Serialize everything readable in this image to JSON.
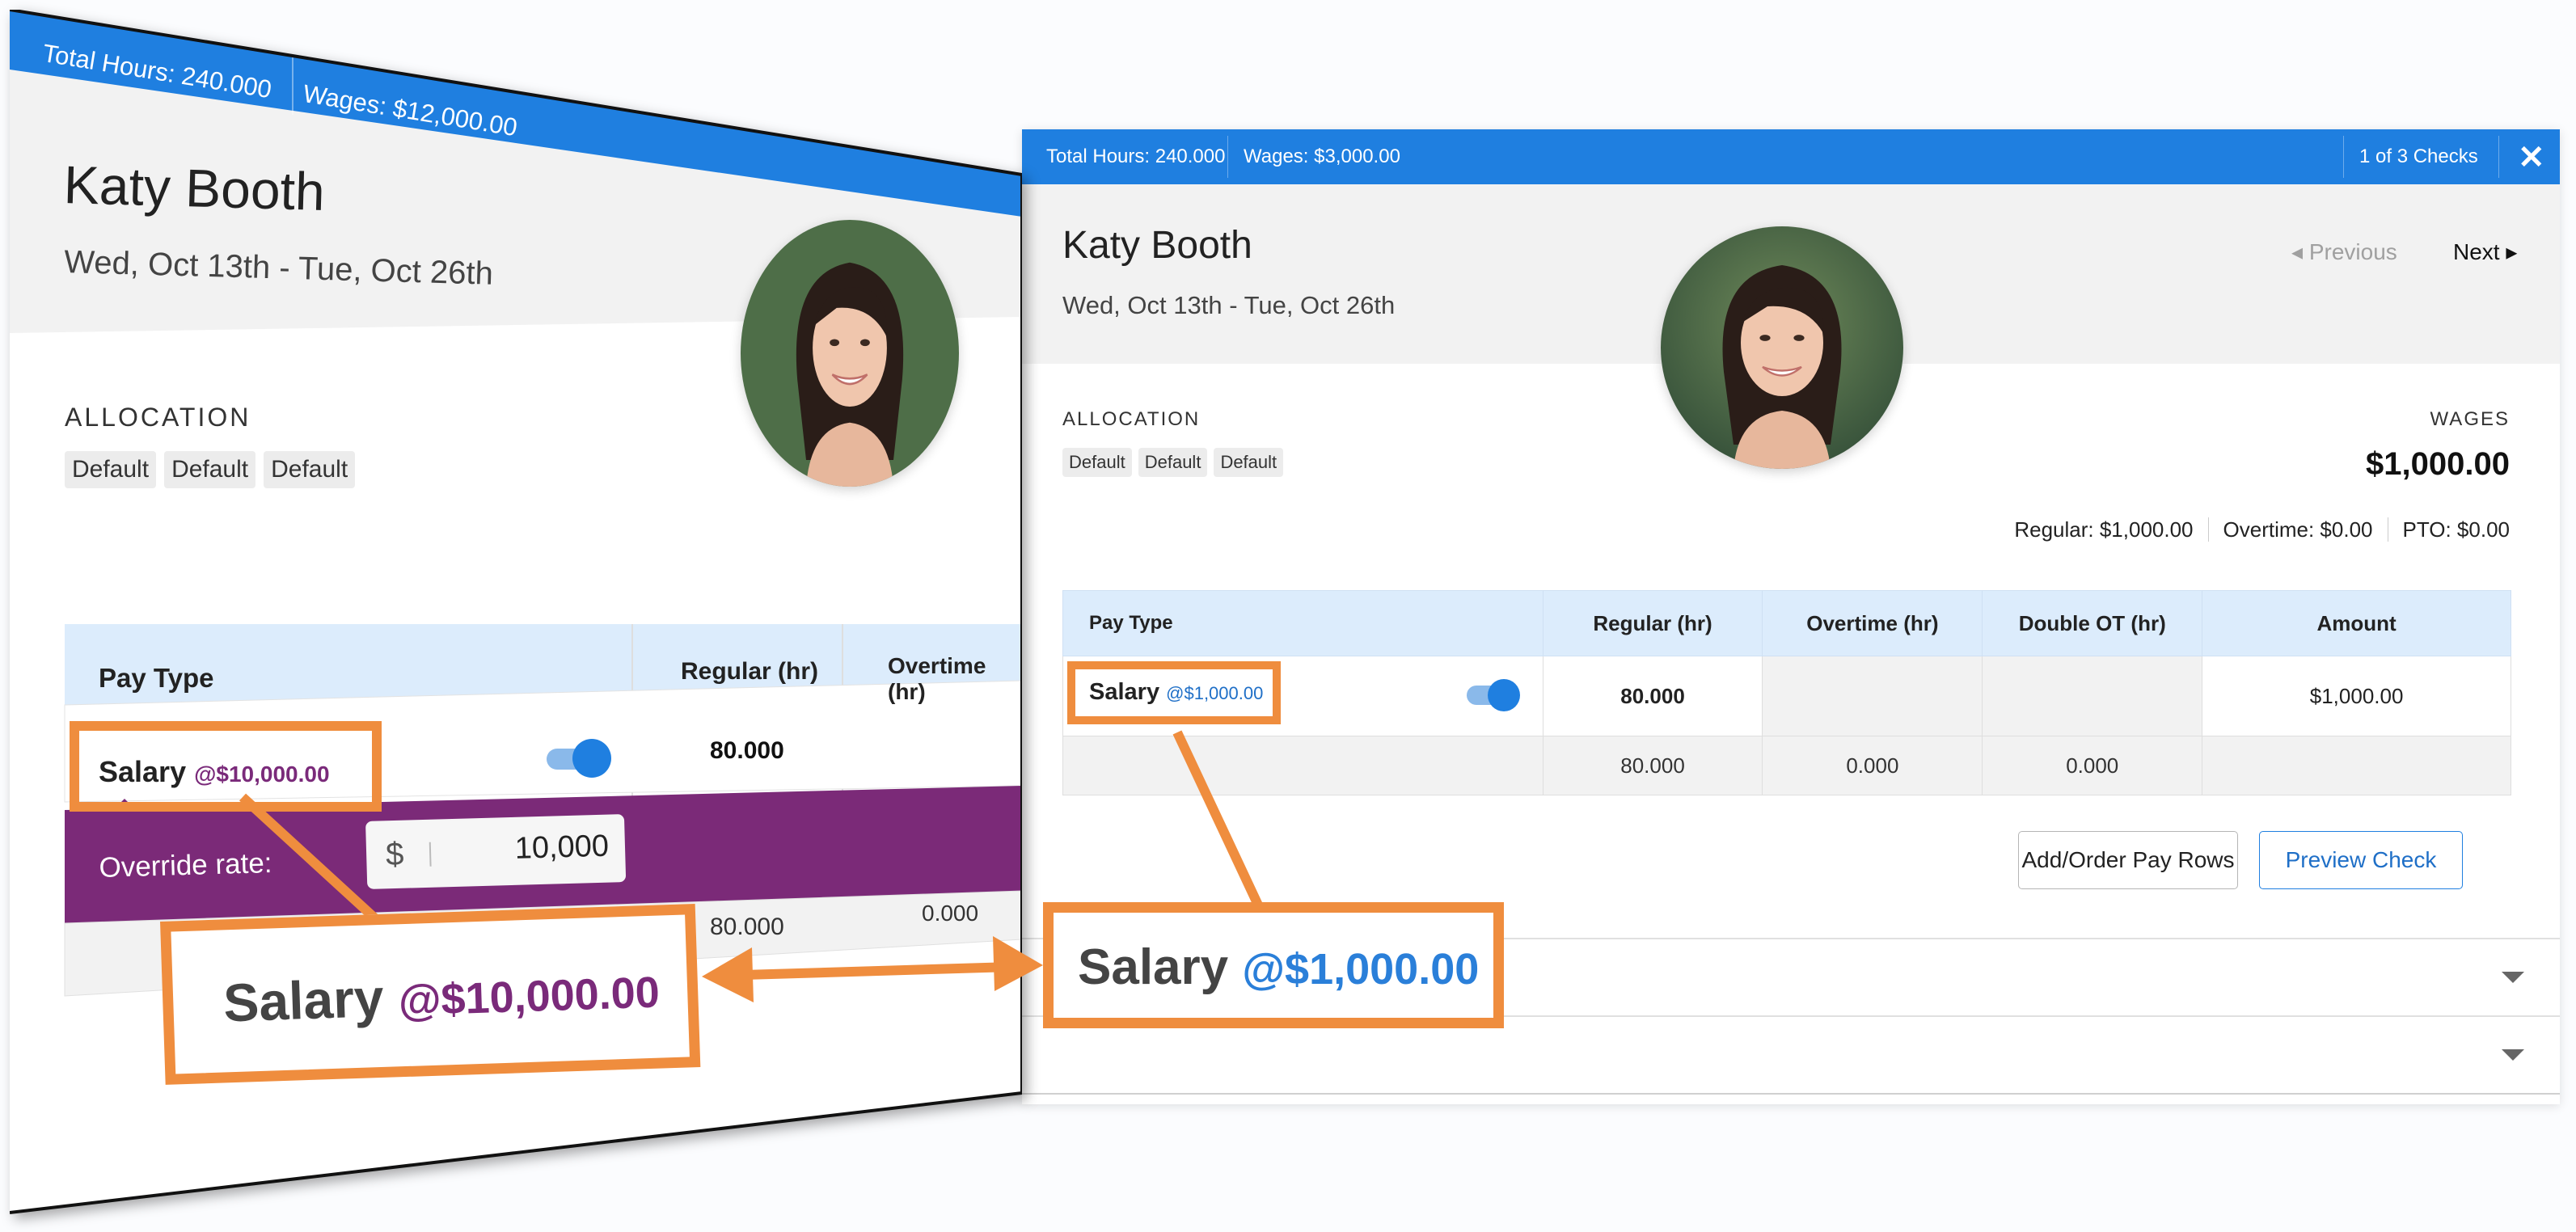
{
  "right": {
    "topbar": {
      "total_hours": "Total Hours: 240.000",
      "wages": "Wages: $3,000.00",
      "checks": "1 of 3 Checks",
      "close_icon": "close-icon"
    },
    "employee": {
      "name": "Katy Booth",
      "period": "Wed, Oct 13th - Tue, Oct 26th"
    },
    "nav": {
      "previous": "◂ Previous",
      "next": "Next ▸"
    },
    "allocation": {
      "label": "ALLOCATION",
      "chips": [
        "Default",
        "Default",
        "Default"
      ]
    },
    "wages": {
      "label": "WAGES",
      "value": "$1,000.00",
      "regular": "Regular: $1,000.00",
      "overtime": "Overtime: $0.00",
      "pto": "PTO: $0.00"
    },
    "table": {
      "headers": [
        "Pay Type",
        "Regular (hr)",
        "Overtime (hr)",
        "Double OT (hr)",
        "Amount"
      ],
      "row": {
        "pay_type": "Salary",
        "rate": "@$1,000.00",
        "regular": "80.000",
        "overtime": "",
        "double_ot": "",
        "amount": "$1,000.00",
        "toggle_on": true
      },
      "totals": {
        "regular": "80.000",
        "overtime": "0.000",
        "double_ot": "0.000"
      }
    },
    "buttons": {
      "add_order": "Add/Order Pay Rows",
      "preview": "Preview Check"
    }
  },
  "left": {
    "topbar": {
      "total_hours": "Total Hours: 240.000",
      "wages": "Wages: $12,000.00"
    },
    "employee": {
      "name": "Katy Booth",
      "period": "Wed, Oct 13th - Tue, Oct 26th"
    },
    "allocation": {
      "label": "ALLOCATION",
      "chips": [
        "Default",
        "Default",
        "Default"
      ]
    },
    "table": {
      "headers": [
        "Pay Type",
        "Regular (hr)",
        "Overtime (hr)"
      ],
      "row": {
        "pay_type": "Salary",
        "rate": "@$10,000.00",
        "regular": "80.000",
        "toggle_on": true
      },
      "override_label": "Override rate:",
      "override_currency": "$",
      "override_value": "10,000",
      "totals": {
        "regular": "80.000",
        "overtime": "0.000"
      }
    }
  },
  "callouts": {
    "left_salary": "Salary",
    "left_rate": "@$10,000.00",
    "right_salary": "Salary",
    "right_rate": "@$1,000.00"
  },
  "colors": {
    "topbar": "#1f7fe0",
    "override_band": "#7b2a78",
    "callout": "#ef8d3e",
    "header_row": "#dcecfc"
  }
}
